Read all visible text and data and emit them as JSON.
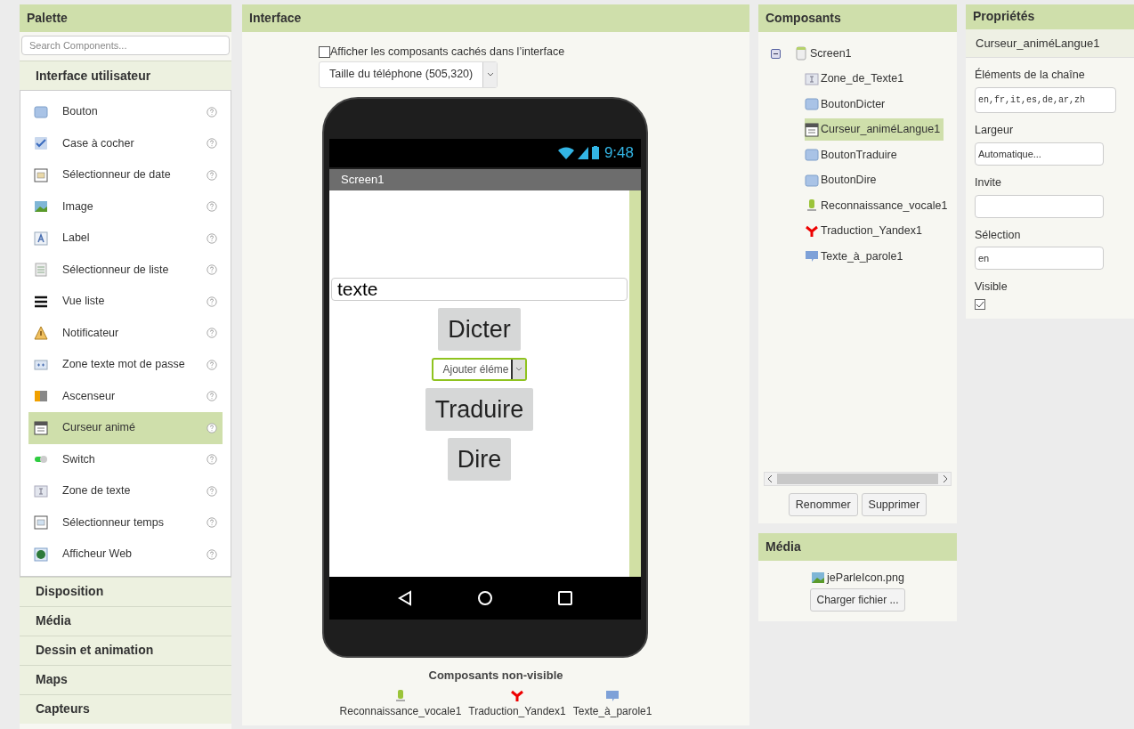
{
  "palette": {
    "title": "Palette",
    "search": {
      "placeholder": "Search Components..."
    },
    "categories": [
      {
        "label": "Interface utilisateur",
        "expanded": true,
        "items": [
          {
            "label": "Bouton",
            "kind": "button",
            "selected": false
          },
          {
            "label": "Case à cocher",
            "kind": "checkbox",
            "selected": false
          },
          {
            "label": "Sélectionneur de date",
            "kind": "date",
            "selected": false
          },
          {
            "label": "Image",
            "kind": "image",
            "selected": false
          },
          {
            "label": "Label",
            "kind": "label",
            "selected": false
          },
          {
            "label": "Sélectionneur de liste",
            "kind": "listpicker",
            "selected": false
          },
          {
            "label": "Vue liste",
            "kind": "listview",
            "selected": false
          },
          {
            "label": "Notificateur",
            "kind": "notifier",
            "selected": false
          },
          {
            "label": "Zone texte mot de passe",
            "kind": "password",
            "selected": false
          },
          {
            "label": "Ascenseur",
            "kind": "slider",
            "selected": false
          },
          {
            "label": "Curseur animé",
            "kind": "spinner",
            "selected": true
          },
          {
            "label": "Switch",
            "kind": "switch",
            "selected": false
          },
          {
            "label": "Zone de texte",
            "kind": "textbox",
            "selected": false
          },
          {
            "label": "Sélectionneur temps",
            "kind": "time",
            "selected": false
          },
          {
            "label": "Afficheur Web",
            "kind": "web",
            "selected": false
          }
        ]
      },
      {
        "label": "Disposition",
        "expanded": false
      },
      {
        "label": "Média",
        "expanded": false
      },
      {
        "label": "Dessin et animation",
        "expanded": false
      },
      {
        "label": "Maps",
        "expanded": false
      },
      {
        "label": "Capteurs",
        "expanded": false
      }
    ]
  },
  "interface": {
    "title": "Interface",
    "show_hidden": {
      "label": "Afficher les composants cachés dans l’interface",
      "checked": false
    },
    "size_select": {
      "value": "Taille du téléphone (505,320)"
    },
    "phone": {
      "time": "9:48",
      "screen_title": "Screen1",
      "widgets": [
        {
          "kind": "textbox",
          "text": "texte"
        },
        {
          "kind": "button",
          "text": "Dicter"
        },
        {
          "kind": "spinner",
          "text": "Ajouter éléme"
        },
        {
          "kind": "button",
          "text": "Traduire"
        },
        {
          "kind": "button",
          "text": "Dire"
        }
      ]
    },
    "non_visible": {
      "title": "Composants non-visible",
      "items": [
        {
          "label": "Reconnaissance_vocale1",
          "kind": "speech"
        },
        {
          "label": "Traduction_Yandex1",
          "kind": "yandex"
        },
        {
          "label": "Texte_à_parole1",
          "kind": "tts"
        }
      ]
    }
  },
  "components": {
    "title": "Composants",
    "tree": [
      {
        "label": "Screen1",
        "kind": "screen",
        "expanded": true,
        "selected": false,
        "children": [
          {
            "label": "Zone_de_Texte1",
            "kind": "textbox",
            "selected": false
          },
          {
            "label": "BoutonDicter",
            "kind": "button",
            "selected": false
          },
          {
            "label": "Curseur_animéLangue1",
            "kind": "spinner",
            "selected": true
          },
          {
            "label": "BoutonTraduire",
            "kind": "button",
            "selected": false
          },
          {
            "label": "BoutonDire",
            "kind": "button",
            "selected": false
          },
          {
            "label": "Reconnaissance_vocale1",
            "kind": "speech",
            "selected": false
          },
          {
            "label": "Traduction_Yandex1",
            "kind": "yandex",
            "selected": false
          },
          {
            "label": "Texte_à_parole1",
            "kind": "tts",
            "selected": false
          }
        ]
      }
    ],
    "buttons": [
      "Renommer",
      "Supprimer"
    ]
  },
  "media": {
    "title": "Média",
    "files": [
      {
        "label": "jeParleIcon.png",
        "kind": "image"
      }
    ],
    "upload_button": "Charger fichier ..."
  },
  "properties": {
    "title": "Propriétés",
    "component": "Curseur_animéLangue1",
    "fields": [
      {
        "label": "Éléments de la chaîne",
        "kind": "textarea",
        "value": "en,fr,it,es,de,ar,zh"
      },
      {
        "label": "Largeur",
        "kind": "text",
        "value": "Automatique..."
      },
      {
        "label": "Invite",
        "kind": "text"
      },
      {
        "label": "Sélection",
        "kind": "text",
        "value": "en"
      },
      {
        "label": "Visible",
        "kind": "checkbox",
        "checked": true
      }
    ]
  }
}
